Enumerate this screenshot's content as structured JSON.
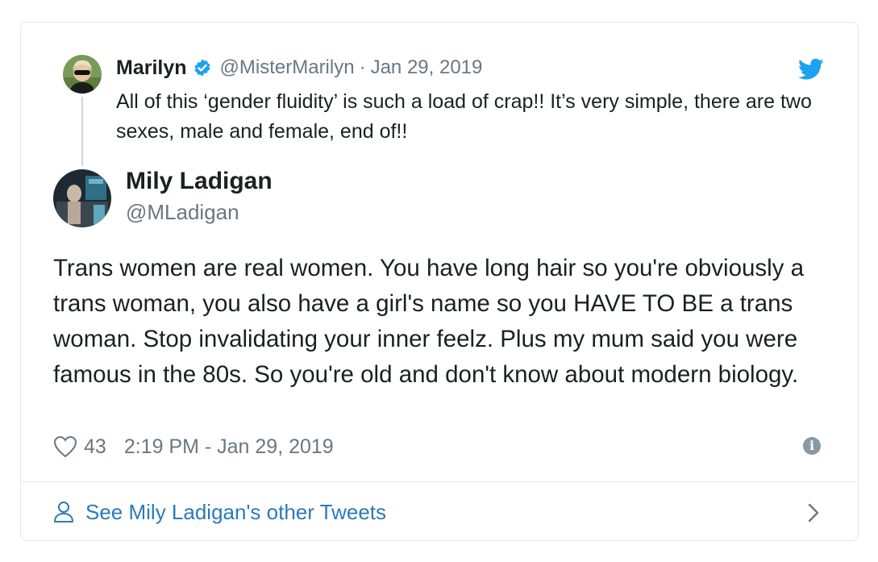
{
  "parent_tweet": {
    "name": "Marilyn",
    "handle": "@MisterMarilyn",
    "separator": "·",
    "date": "Jan 29, 2019",
    "text": "All of this ‘gender fluidity’ is such a load of crap!! It’s very simple, there are two sexes, male and female, end of!!"
  },
  "main_tweet": {
    "name": "Mily Ladigan",
    "handle": "@MLadigan",
    "text": "Trans women are real women. You have long hair so you're obviously a trans woman, you also have a girl's name so you HAVE TO BE a trans woman. Stop invalidating your inner feelz. Plus my mum said you were famous in the 80s. So you're old and don't know about modern biology.",
    "like_count": "43",
    "timestamp": "2:19 PM - Jan 29, 2019"
  },
  "footer": {
    "link_label": "See Mily Ladigan's other Tweets"
  },
  "icons": {
    "verified": "verified-badge-icon",
    "brand": "twitter-bird-icon",
    "like": "heart-icon",
    "info": "info-icon",
    "profile": "person-icon",
    "more": "chevron-right-icon"
  },
  "colors": {
    "brand_blue": "#1da1f2",
    "link_blue": "#2b7bb9",
    "text": "#1c2022",
    "muted": "#697882",
    "border": "#e1e8ed"
  }
}
